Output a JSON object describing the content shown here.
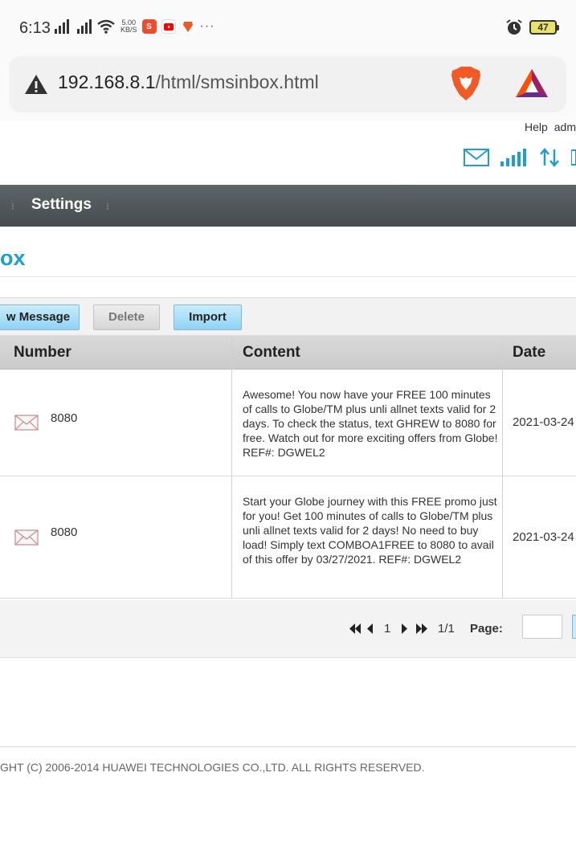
{
  "status_bar": {
    "time": "6:13",
    "speed_value": "5.00",
    "speed_unit": "KB/S",
    "overflow": "···",
    "battery": "47"
  },
  "browser": {
    "url_host": "192.168.8.1",
    "url_path": "/html/smsinbox.html"
  },
  "header": {
    "help": "Help",
    "user": "adm"
  },
  "nav": {
    "settings": "Settings"
  },
  "page": {
    "title": "ox"
  },
  "toolbar": {
    "new_message": "w Message",
    "delete": "Delete",
    "import": "Import"
  },
  "table": {
    "columns": {
      "number": "Number",
      "content": "Content",
      "date": "Date"
    },
    "rows": [
      {
        "number": "8080",
        "content": "Awesome! You now have your FREE 100 minutes of calls to Globe/TM plus unli allnet texts valid for 2 days. To check the status, text GHREW to 8080 for free. Watch out for more exciting offers from Globe! REF#: DGWEL2",
        "date": "2021-03-24"
      },
      {
        "number": "8080",
        "content": "Start your Globe journey with this FREE promo just for you! Get 100 minutes of calls to Globe/TM plus unli allnet texts valid for 2 days! No need to buy load! Simply text COMBOA1FREE to 8080 to avail of this offer by 03/27/2021. REF#: DGWEL2",
        "date": "2021-03-24"
      }
    ]
  },
  "pager": {
    "current": "1",
    "total": "1/1",
    "page_label": "Page:"
  },
  "footer": {
    "copyright": "GHT (C) 2006-2014 HUAWEI TECHNOLOGIES CO.,LTD. ALL RIGHTS RESERVED."
  }
}
